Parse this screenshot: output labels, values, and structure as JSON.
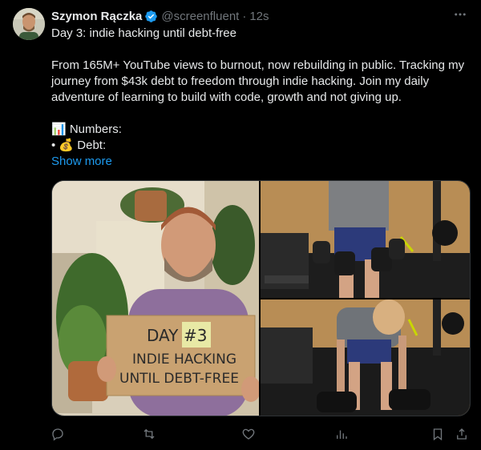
{
  "author": {
    "name": "Szymon Rączka",
    "handle": "@screenfluent",
    "separator": "·",
    "time": "12s",
    "verified_color": "#1d9bf0"
  },
  "tweet": {
    "title": "Day 3: indie hacking until debt-free",
    "paragraph": "From 165M+ YouTube views to burnout, now rebuilding in public. Tracking my journey from $43k debt to freedom through indie hacking. Join my daily adventure of learning to build with code, growth and not giving up.",
    "numbers_line": "📊 Numbers:",
    "debt_line": "• 💰 Debt:",
    "show_more": "Show more"
  },
  "media": {
    "sign_lines": [
      "DAY",
      "#3",
      "INDIE HACKING",
      "UNTIL DEBT-FREE"
    ]
  },
  "actions": {
    "reply_icon": "reply-icon",
    "retweet_icon": "retweet-icon",
    "like_icon": "like-icon",
    "views_icon": "views-icon",
    "bookmark_icon": "bookmark-icon",
    "share_icon": "share-icon"
  },
  "colors": {
    "background": "#000000",
    "text": "#e7e9ea",
    "muted": "#71767b",
    "link": "#1d9bf0"
  }
}
